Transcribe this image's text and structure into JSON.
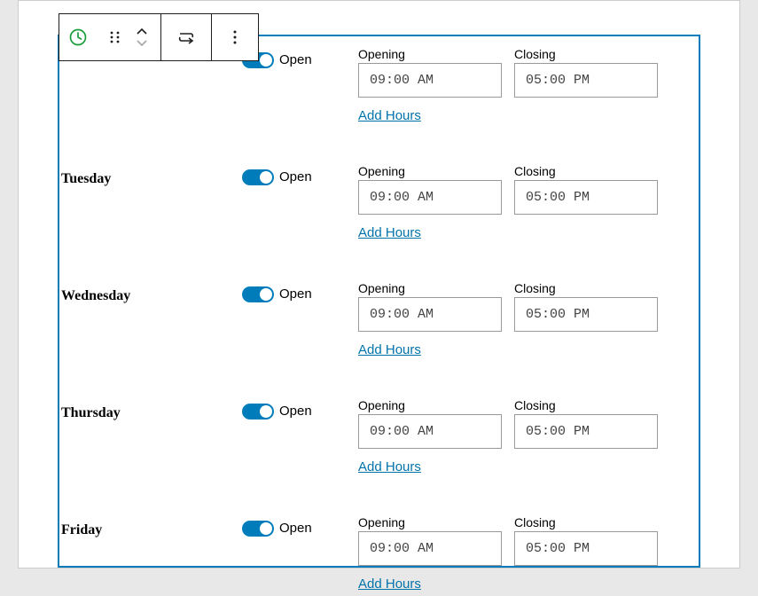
{
  "labels": {
    "open_toggle": "Open",
    "opening": "Opening",
    "closing": "Closing",
    "add_hours": "Add Hours"
  },
  "days": [
    {
      "name": "",
      "opening": "09:00 AM",
      "closing": "05:00 PM"
    },
    {
      "name": "Tuesday",
      "opening": "09:00 AM",
      "closing": "05:00 PM"
    },
    {
      "name": "Wednesday",
      "opening": "09:00 AM",
      "closing": "05:00 PM"
    },
    {
      "name": "Thursday",
      "opening": "09:00 AM",
      "closing": "05:00 PM"
    },
    {
      "name": "Friday",
      "opening": "09:00 AM",
      "closing": "05:00 PM"
    }
  ]
}
